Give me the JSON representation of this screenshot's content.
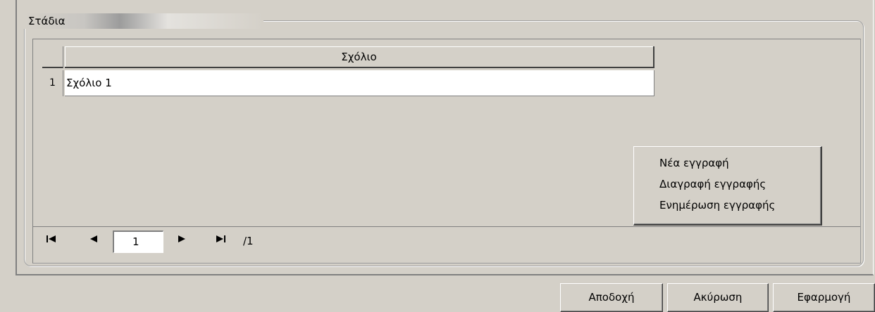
{
  "group": {
    "title": "Στάδια"
  },
  "grid": {
    "column_header": "Σχόλιο",
    "rows": [
      {
        "num": "1",
        "value": "Σχόλιο 1"
      }
    ]
  },
  "context_menu": {
    "items": [
      "Νέα εγγραφή",
      "Διαγραφή εγγραφής",
      "Ενημέρωση εγγραφής"
    ]
  },
  "navigator": {
    "first_icon": "first-page-icon",
    "prev_icon": "prev-page-icon",
    "next_icon": "next-page-icon",
    "last_icon": "last-page-icon",
    "current_page": "1",
    "total_pages": "/1"
  },
  "buttons": {
    "accept": "Αποδοχή",
    "cancel": "Ακύρωση",
    "apply": "Εφαρμογή"
  }
}
